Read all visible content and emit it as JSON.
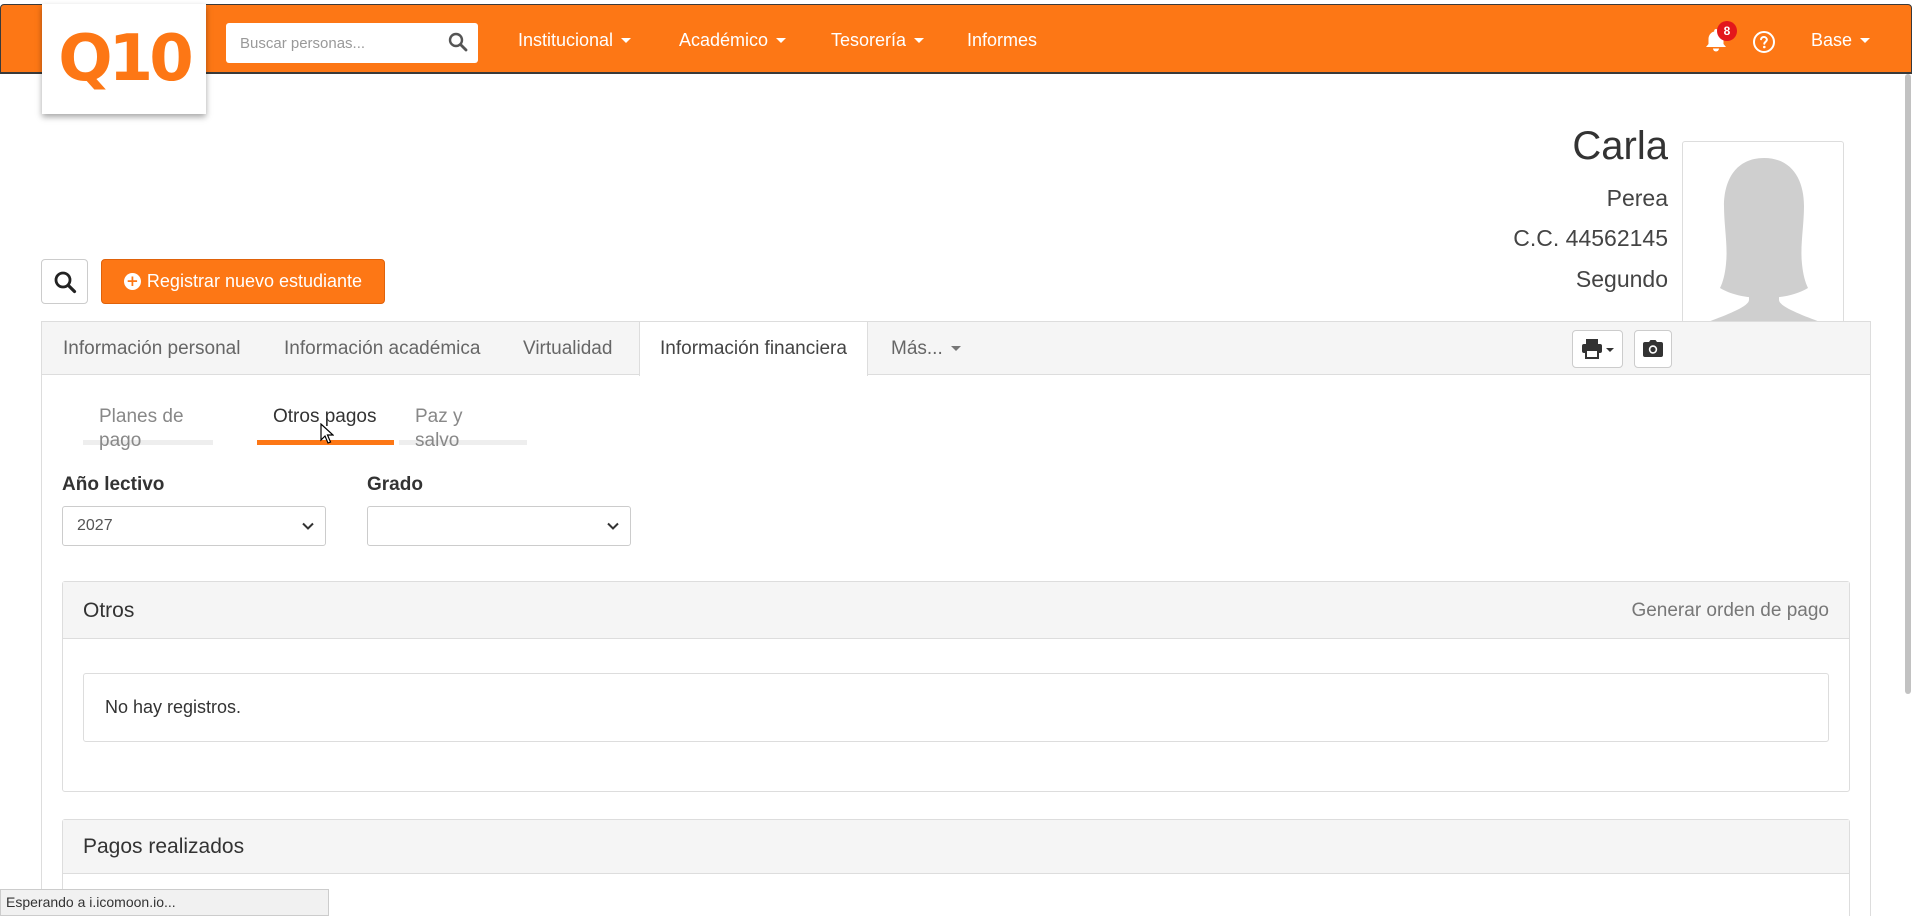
{
  "header": {
    "logo_text": "Q10",
    "search_placeholder": "Buscar personas...",
    "nav": [
      {
        "label": "Institucional",
        "has_caret": true
      },
      {
        "label": "Académico",
        "has_caret": true
      },
      {
        "label": "Tesorería",
        "has_caret": true
      },
      {
        "label": "Informes",
        "has_caret": false
      }
    ],
    "notification_count": "8",
    "user_menu_label": "Base",
    "brand_color": "#fd7715"
  },
  "profile": {
    "first_name": "Carla",
    "last_name": "Perea",
    "document": "C.C. 44562145",
    "extra_line": "Segundo"
  },
  "actions": {
    "register_label": "Registrar nuevo estudiante"
  },
  "tabs": [
    {
      "label": "Información personal"
    },
    {
      "label": "Información académica"
    },
    {
      "label": "Virtualidad"
    },
    {
      "label": "Información financiera",
      "active": true
    },
    {
      "label": "Más..."
    }
  ],
  "subtabs": [
    {
      "label": "Planes de pago"
    },
    {
      "label": "Otros pagos",
      "active": true
    },
    {
      "label": "Paz y salvo"
    }
  ],
  "filters": {
    "year_label": "Año lectivo",
    "year_value": "2027",
    "grade_label": "Grado",
    "grade_value": ""
  },
  "others_box": {
    "title": "Otros",
    "link": "Generar orden de pago",
    "empty_text": "No hay registros."
  },
  "payments_box": {
    "title": "Pagos realizados"
  },
  "status_bar": {
    "text": "Esperando a i.icomoon.io..."
  }
}
